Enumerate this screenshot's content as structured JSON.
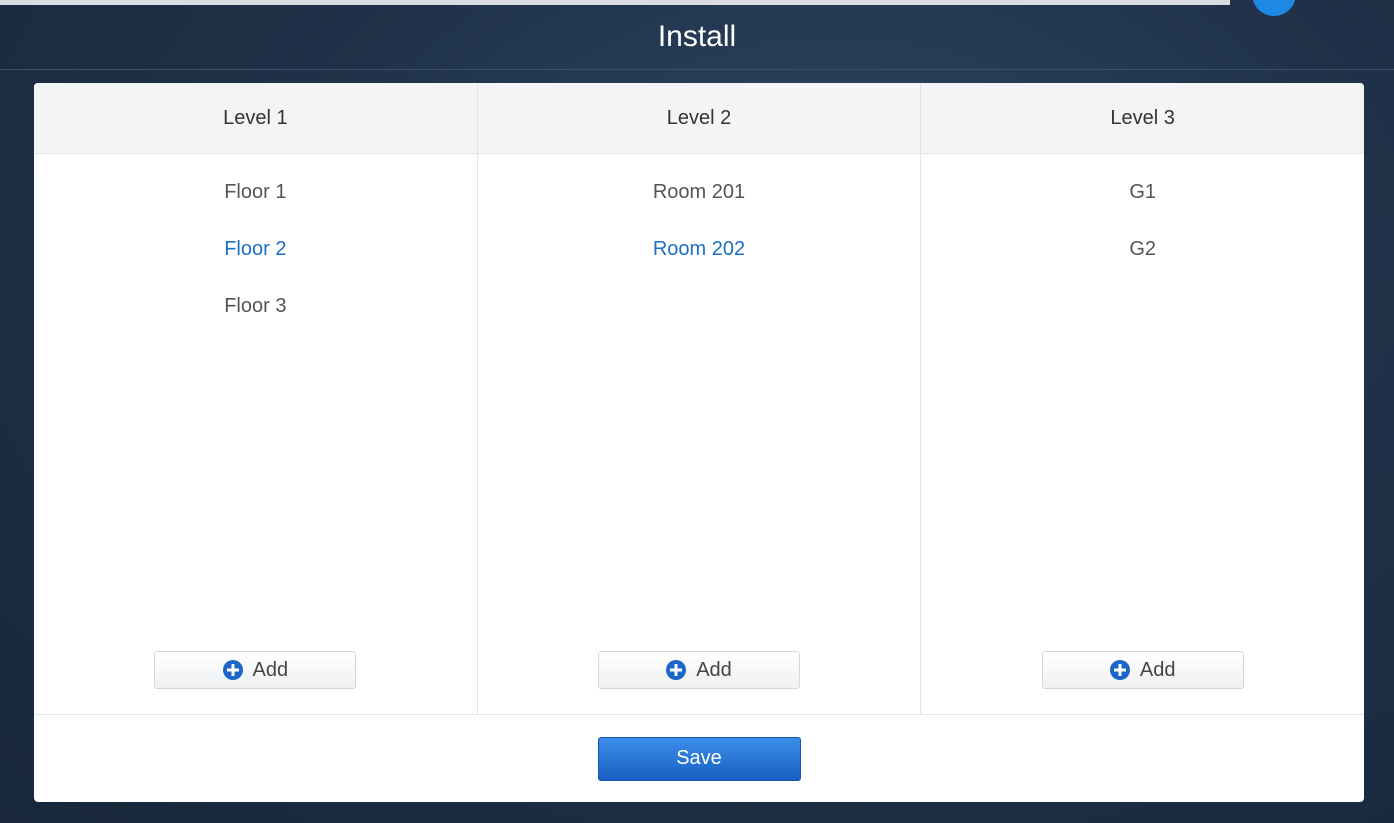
{
  "header": {
    "title": "Install"
  },
  "columns": [
    {
      "header": "Level 1",
      "items": [
        {
          "label": "Floor 1",
          "selected": false
        },
        {
          "label": "Floor 2",
          "selected": true
        },
        {
          "label": "Floor 3",
          "selected": false
        }
      ],
      "add_label": "Add"
    },
    {
      "header": "Level 2",
      "items": [
        {
          "label": "Room 201",
          "selected": false
        },
        {
          "label": "Room 202",
          "selected": true
        }
      ],
      "add_label": "Add"
    },
    {
      "header": "Level 3",
      "items": [
        {
          "label": "G1",
          "selected": false
        },
        {
          "label": "G2",
          "selected": false
        }
      ],
      "add_label": "Add"
    }
  ],
  "footer": {
    "save_label": "Save"
  },
  "icons": {
    "add": "plus-circle-icon"
  },
  "colors": {
    "accent": "#1c6fc2",
    "save_button": "#2a7ad6",
    "header_bg": "#1f3249"
  }
}
